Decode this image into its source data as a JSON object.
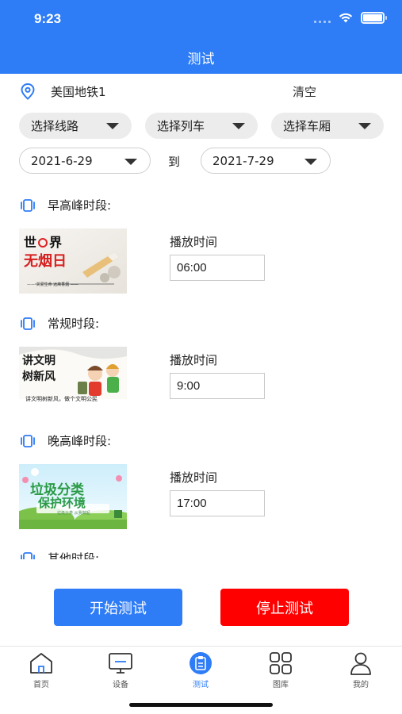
{
  "status": {
    "time": "9:23"
  },
  "header": {
    "title": "测试"
  },
  "location": {
    "name": "美国地铁1",
    "clear_label": "清空"
  },
  "selects": [
    {
      "label": "选择线路"
    },
    {
      "label": "选择列车"
    },
    {
      "label": "选择车厢"
    }
  ],
  "dates": {
    "start": "2021-6-29",
    "to": "到",
    "end": "2021-7-29"
  },
  "periods": [
    {
      "label": "早高峰时段:",
      "play_label": "播放时间",
      "time": "06:00",
      "thumb": {
        "line1": "世",
        "line1b": "界",
        "line2": "无烟日",
        "caption": "—— 关爱生命  远离香烟 ——"
      }
    },
    {
      "label": "常规时段:",
      "play_label": "播放时间",
      "time": "9:00",
      "thumb": {
        "line1": "讲文明",
        "line2": "树新风",
        "caption": "讲文明树新风，做个文明公民"
      }
    },
    {
      "label": "晚高峰时段:",
      "play_label": "播放时间",
      "time": "17:00",
      "thumb": {
        "line1": "垃圾分类",
        "line2": "保护环境",
        "caption": "垃圾分类 从我做起"
      }
    },
    {
      "label": "其他时段:"
    }
  ],
  "actions": {
    "start": "开始测试",
    "stop": "停止测试"
  },
  "tabbar": [
    {
      "label": "首页",
      "icon": "home-icon"
    },
    {
      "label": "设备",
      "icon": "monitor-icon"
    },
    {
      "label": "测试",
      "icon": "test-icon",
      "active": true
    },
    {
      "label": "图库",
      "icon": "gallery-icon"
    },
    {
      "label": "我的",
      "icon": "user-icon"
    }
  ],
  "colors": {
    "primary": "#2e7cf6",
    "stop": "#ff0000"
  }
}
